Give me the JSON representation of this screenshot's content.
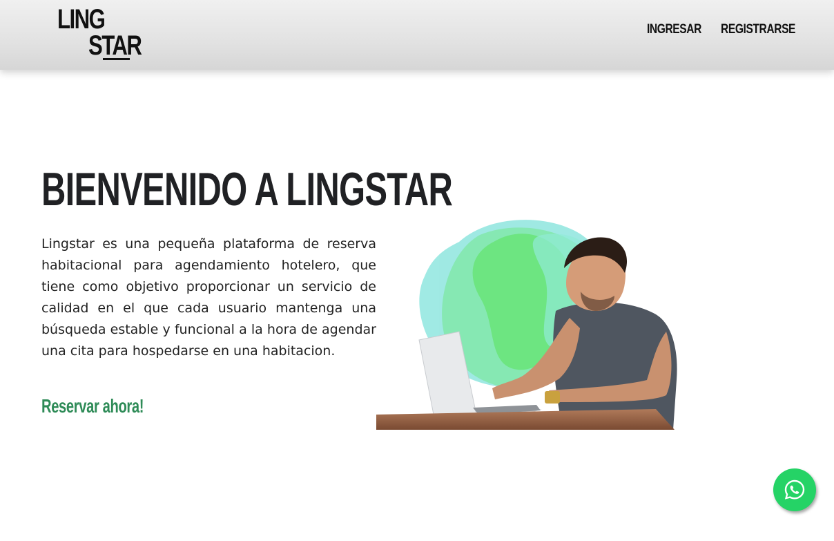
{
  "header": {
    "logo": {
      "line1": "LING",
      "line2": "STAR"
    },
    "nav": {
      "login": "INGRESAR",
      "register": "REGISTRARSE"
    }
  },
  "hero": {
    "title": "BIENVENIDO A LINGSTAR",
    "description": "Lingstar es una pequeña plataforma de reserva habitacional para agendamiento hotelero, que tiene como objetivo proporcionar un servicio de calidad en el que cada usuario mantenga una búsqueda estable y funcional a la hora de agendar una cita para hospedarse en una habitacion.",
    "cta_label": "Reservar ahora!",
    "image": {
      "subject": "man-typing-on-laptop",
      "blob_colors": [
        "#7ee0d8",
        "#5fe07a",
        "#3ee06a"
      ]
    }
  },
  "floating": {
    "whatsapp_icon": "whatsapp-icon",
    "whatsapp_color": "#25d366"
  },
  "colors": {
    "accent": "#2e8b57",
    "title": "#202124"
  }
}
